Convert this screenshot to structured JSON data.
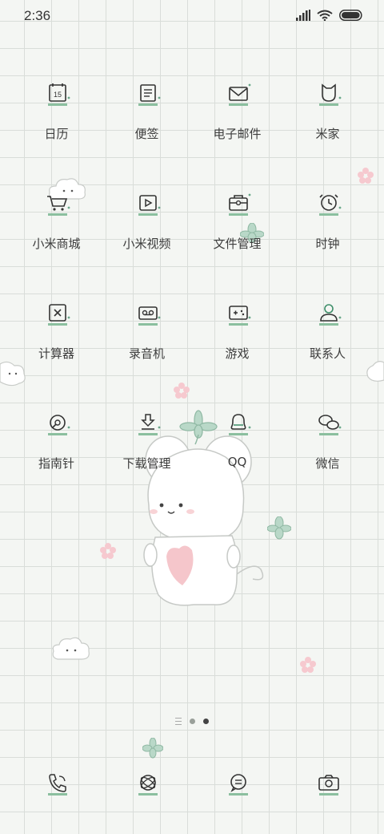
{
  "status": {
    "time": "2:36",
    "battery": "full"
  },
  "apps": [
    [
      {
        "label": "日历",
        "icon": "calendar-icon",
        "badge": "15"
      },
      {
        "label": "便签",
        "icon": "notes-icon"
      },
      {
        "label": "电子邮件",
        "icon": "mail-icon"
      },
      {
        "label": "米家",
        "icon": "mijia-icon"
      }
    ],
    [
      {
        "label": "小米商城",
        "icon": "cart-icon"
      },
      {
        "label": "小米视频",
        "icon": "video-icon"
      },
      {
        "label": "文件管理",
        "icon": "folder-icon"
      },
      {
        "label": "时钟",
        "icon": "clock-icon"
      }
    ],
    [
      {
        "label": "计算器",
        "icon": "calculator-icon"
      },
      {
        "label": "录音机",
        "icon": "recorder-icon"
      },
      {
        "label": "游戏",
        "icon": "gamepad-icon"
      },
      {
        "label": "联系人",
        "icon": "contacts-icon"
      }
    ],
    [
      {
        "label": "指南针",
        "icon": "compass-icon"
      },
      {
        "label": "下载管理",
        "icon": "download-icon"
      },
      {
        "label": "QQ",
        "icon": "qq-icon"
      },
      {
        "label": "微信",
        "icon": "wechat-icon"
      }
    ]
  ],
  "dock": [
    {
      "icon": "phone-icon"
    },
    {
      "icon": "browser-icon"
    },
    {
      "icon": "messages-icon"
    },
    {
      "icon": "camera-icon"
    }
  ],
  "pages": {
    "count": 2,
    "current": 2
  },
  "colors": {
    "accent": "#6aa88a",
    "grid": "#d9ddd9",
    "background": "#f4f6f3"
  }
}
